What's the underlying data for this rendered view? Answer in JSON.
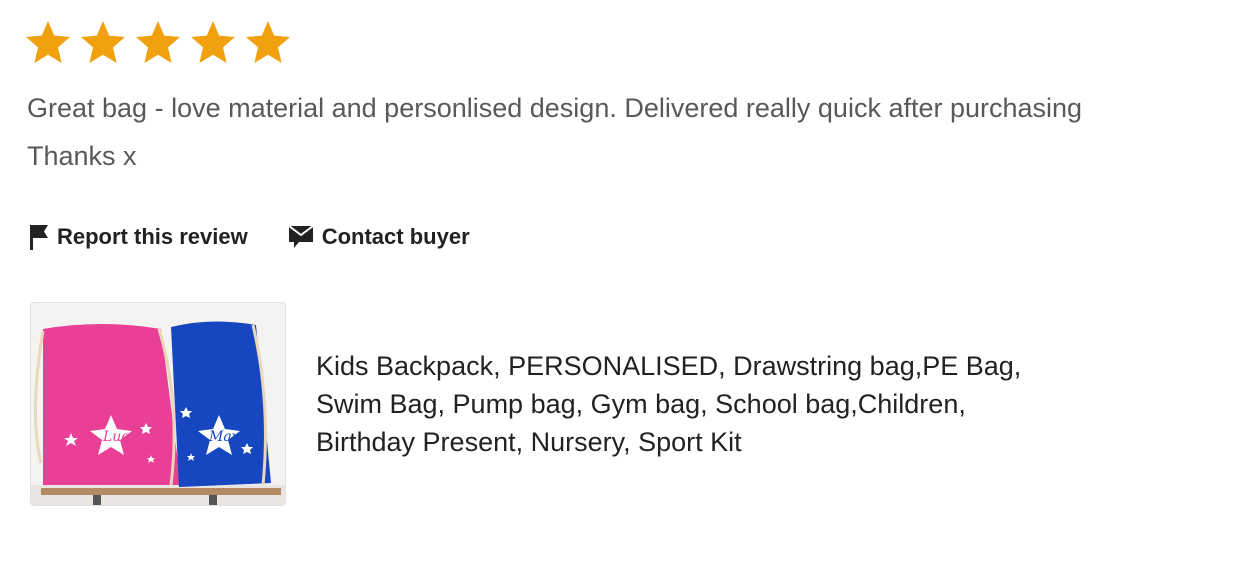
{
  "review": {
    "rating": 5,
    "rating_max": 5,
    "star_color": "#f1a10d",
    "text_line1": "Great bag - love material and personlised design. Delivered really quick after purchasing",
    "text_line2": "Thanks x"
  },
  "actions": {
    "report": {
      "label": "Report this review",
      "icon": "flag-icon"
    },
    "contact": {
      "label": "Contact buyer",
      "icon": "message-icon"
    }
  },
  "listing": {
    "image_text_left": "Lucy",
    "image_text_right": "Max",
    "bag_colors": {
      "left": "#ea3f96",
      "right": "#1646c0"
    },
    "title_line1": "Kids Backpack, PERSONALISED, Drawstring bag,PE Bag,",
    "title_line2": "Swim Bag, Pump bag, Gym bag, School bag,Children,",
    "title_line3": "Birthday Present, Nursery, Sport Kit"
  }
}
